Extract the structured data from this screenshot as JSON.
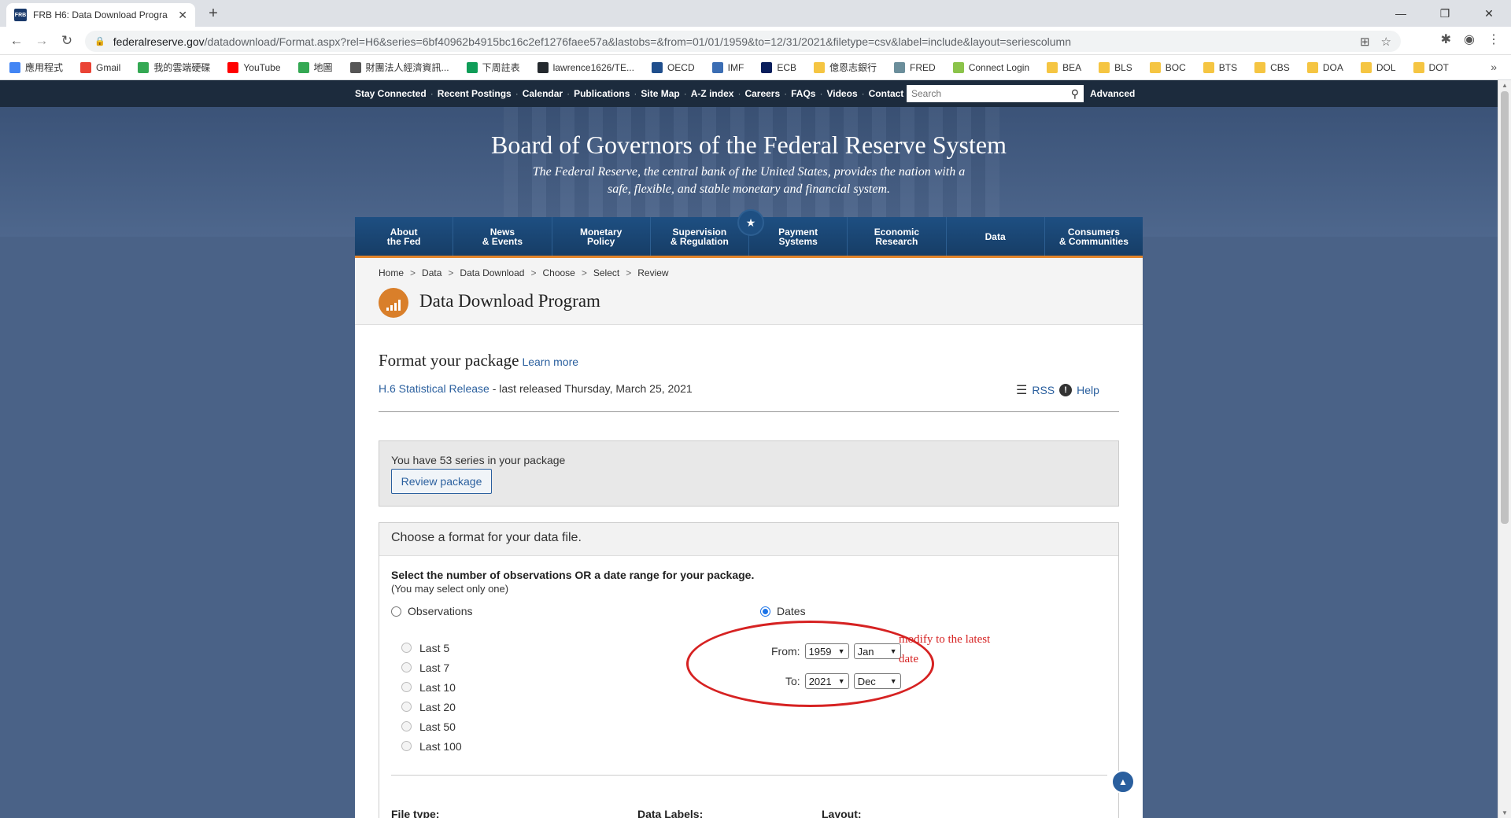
{
  "browser": {
    "tab_title": "FRB H6: Data Download Progra",
    "favicon_text": "FRB",
    "url_host": "federalreserve.gov",
    "url_path": "/datadownload/Format.aspx?rel=H6&series=6bf40962b4915bc16c2ef1276faee57a&lastobs=&from=01/01/1959&to=12/31/2021&filetype=csv&label=include&layout=seriescolumn"
  },
  "bookmarks": [
    {
      "label": "應用程式",
      "color": "#4285f4"
    },
    {
      "label": "Gmail",
      "color": "#ea4335"
    },
    {
      "label": "我的雲端硬碟",
      "color": "#34a853"
    },
    {
      "label": "YouTube",
      "color": "#ff0000"
    },
    {
      "label": "地圖",
      "color": "#34a853"
    },
    {
      "label": "財團法人經濟資訊...",
      "color": "#555555"
    },
    {
      "label": "下周註表",
      "color": "#0f9d58"
    },
    {
      "label": "lawrence1626/TE...",
      "color": "#24292e"
    },
    {
      "label": "OECD",
      "color": "#1f4e8c"
    },
    {
      "label": "IMF",
      "color": "#3b6db3"
    },
    {
      "label": "ECB",
      "color": "#0a1e5c"
    },
    {
      "label": "億恩志銀行",
      "color": "#f5c542"
    },
    {
      "label": "FRED",
      "color": "#6b8e9b"
    },
    {
      "label": "Connect Login",
      "color": "#8bc34a"
    },
    {
      "label": "BEA",
      "color": "#f5c542"
    },
    {
      "label": "BLS",
      "color": "#f5c542"
    },
    {
      "label": "BOC",
      "color": "#f5c542"
    },
    {
      "label": "BTS",
      "color": "#f5c542"
    },
    {
      "label": "CBS",
      "color": "#f5c542"
    },
    {
      "label": "DOA",
      "color": "#f5c542"
    },
    {
      "label": "DOL",
      "color": "#f5c542"
    },
    {
      "label": "DOT",
      "color": "#f5c542"
    }
  ],
  "util_nav": [
    "Stay Connected",
    "Recent Postings",
    "Calendar",
    "Publications",
    "Site Map",
    "A-Z index",
    "Careers",
    "FAQs",
    "Videos",
    "Contact"
  ],
  "search": {
    "placeholder": "Search",
    "advanced": "Advanced"
  },
  "header": {
    "title": "Board of Governors of the Federal Reserve System",
    "tagline_1": "The Federal Reserve, the central bank of the United States, provides the nation with a",
    "tagline_2": "safe, flexible, and stable monetary and financial system."
  },
  "main_nav": [
    {
      "l1": "About",
      "l2": "the Fed"
    },
    {
      "l1": "News",
      "l2": "& Events"
    },
    {
      "l1": "Monetary",
      "l2": "Policy"
    },
    {
      "l1": "Supervision",
      "l2": "& Regulation"
    },
    {
      "l1": "Payment",
      "l2": "Systems"
    },
    {
      "l1": "Economic",
      "l2": "Research"
    },
    {
      "l1": "Data",
      "l2": ""
    },
    {
      "l1": "Consumers",
      "l2": "& Communities"
    }
  ],
  "breadcrumb": [
    "Home",
    "Data",
    "Data Download",
    "Choose",
    "Select",
    "Review"
  ],
  "page": {
    "title": "Data Download Program",
    "format_title": "Format your package",
    "learn_more": "Learn more",
    "release_link": "H.6 Statistical Release",
    "release_suffix": " - last released Thursday, March 25, 2021",
    "rss": "RSS",
    "help": "Help"
  },
  "package": {
    "summary": "You have 53 series in your package",
    "review_button": "Review package"
  },
  "format_panel": {
    "heading": "Choose a format for your data file.",
    "obs_heading": "Select the number of observations OR a date range for your package.",
    "obs_note": "(You may select only one)",
    "observations_label": "Observations",
    "dates_label": "Dates",
    "last_options": [
      "Last 5",
      "Last 7",
      "Last 10",
      "Last 20",
      "Last 50",
      "Last 100"
    ],
    "from_label": "From:",
    "to_label": "To:",
    "from_year": "1959",
    "from_month": "Jan",
    "to_year": "2021",
    "to_month": "Dec",
    "annotation": "modify to the latest date",
    "file_type_label": "File type:",
    "data_labels_label": "Data Labels:",
    "layout_label": "Layout:"
  },
  "colors": {
    "accent": "#e3852b",
    "link": "#2a5f9e",
    "annotation": "#d62222"
  }
}
